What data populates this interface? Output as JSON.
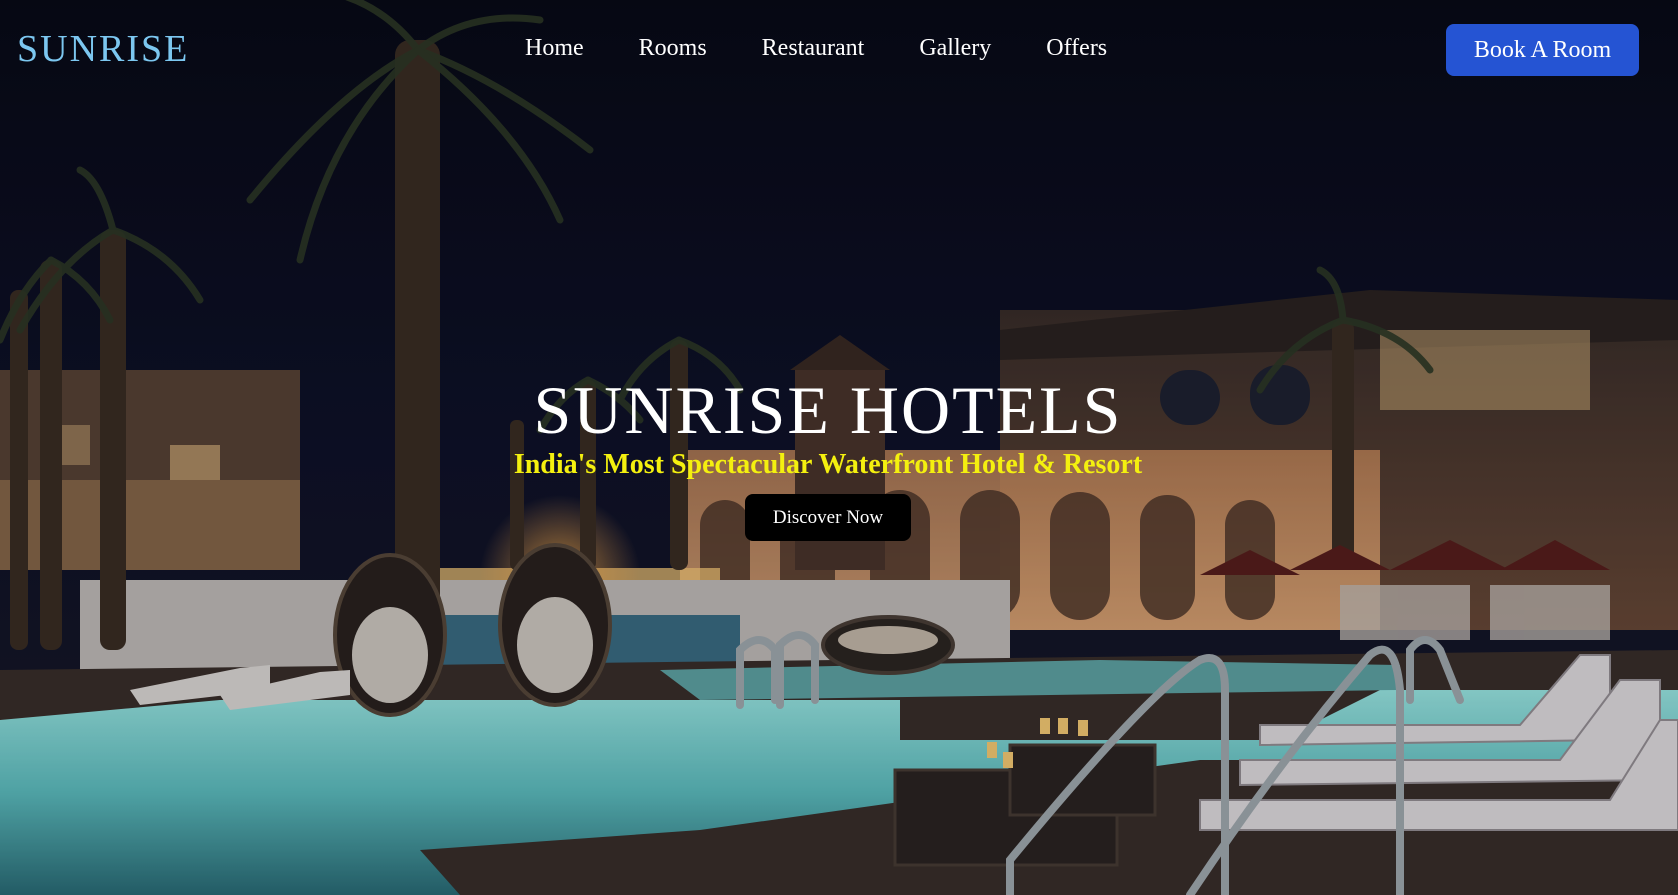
{
  "brand": {
    "logo_text": "SUNRISE"
  },
  "nav": {
    "items": [
      {
        "label": "Home"
      },
      {
        "label": "Rooms"
      },
      {
        "label": "Restaurant"
      },
      {
        "label": "Gallery"
      },
      {
        "label": "Offers"
      }
    ],
    "cta_label": "Book A Room"
  },
  "hero": {
    "title": "SUNRISE HOTELS",
    "subtitle": "India's Most Spectacular Waterfront Hotel & Resort",
    "button_label": "Discover Now"
  },
  "colors": {
    "logo": "#7cc7f0",
    "cta_background": "#2554d3",
    "subtitle": "#f4f00f",
    "discover_background": "#000000",
    "sky": "#0b0d1c",
    "pool": "#7fe0dc"
  }
}
